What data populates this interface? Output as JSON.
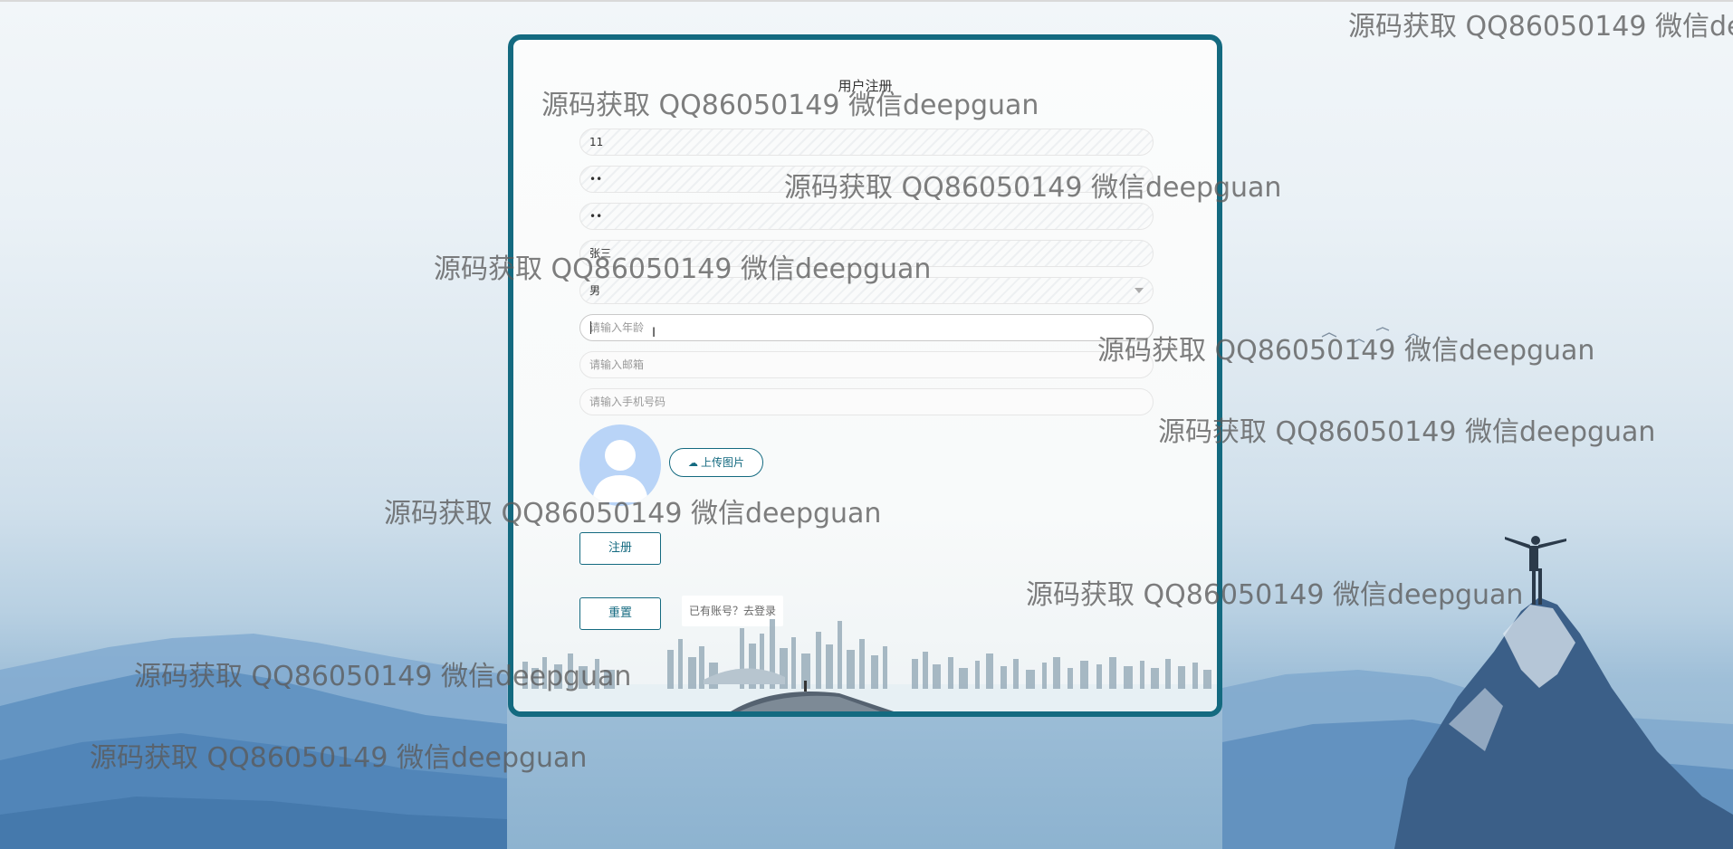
{
  "form": {
    "title": "用户注册",
    "username_value": "11",
    "password_value": "••",
    "confirm_value": "••",
    "name_value": "张三",
    "gender_value": "男",
    "age_placeholder": "请输入年龄",
    "email_placeholder": "请输入邮箱",
    "phone_placeholder": "请输入手机号码",
    "upload_label": "上传图片",
    "register_label": "注册",
    "reset_label": "重置",
    "login_link": "已有账号？去登录"
  },
  "watermark": "源码获取 QQ86050149 微信deepguan",
  "watermark_cut": "源码获取 QQ86050149 微信de",
  "colors": {
    "accent": "#146a80",
    "avatar": "#b9d4f7",
    "sky": "#eaf1f6",
    "mountain": "#4a7fb3"
  }
}
